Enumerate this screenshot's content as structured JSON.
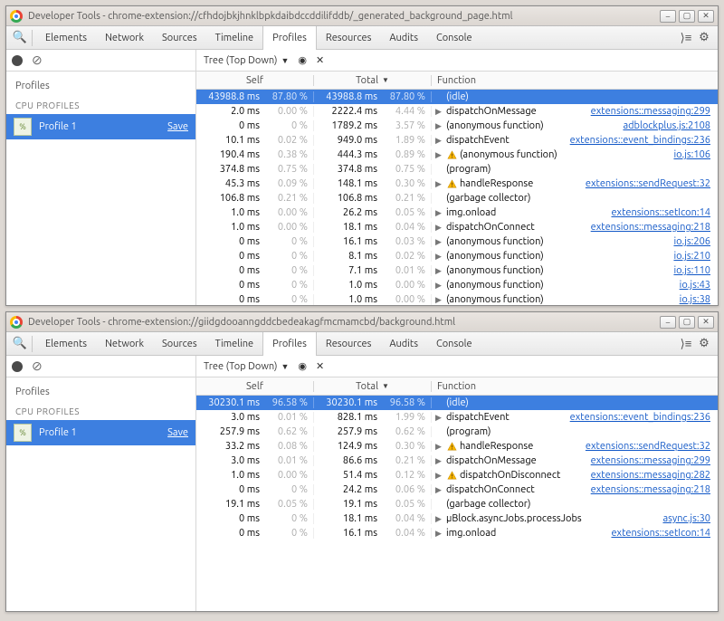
{
  "tabs": [
    "Elements",
    "Network",
    "Sources",
    "Timeline",
    "Profiles",
    "Resources",
    "Audits",
    "Console"
  ],
  "activeTab": "Profiles",
  "sidebar": {
    "profiles_label": "Profiles",
    "cpu_label": "CPU PROFILES",
    "profile": {
      "name": "Profile 1",
      "save": "Save"
    }
  },
  "tree": {
    "mode": "Tree (Top Down)",
    "col_self": "Self",
    "col_total": "Total",
    "col_fn": "Function"
  },
  "windows": [
    {
      "title": "Developer Tools - chrome-extension://cfhdojbkjhnklbpkdaibdccddilifddb/_generated_background_page.html",
      "rows": [
        {
          "sel": true,
          "s": "43988.8 ms",
          "sp": "87.80 %",
          "t": "43988.8 ms",
          "tp": "87.80 %",
          "fn": "(idle)"
        },
        {
          "s": "2.0 ms",
          "sp": "0.00 %",
          "t": "2222.4 ms",
          "tp": "4.44 %",
          "tri": true,
          "fn": "dispatchOnMessage",
          "link": "extensions::messaging:299"
        },
        {
          "s": "0 ms",
          "sp": "0 %",
          "t": "1789.2 ms",
          "tp": "3.57 %",
          "tri": true,
          "fn": "(anonymous function)",
          "link": "adblockplus.js:2108"
        },
        {
          "s": "10.1 ms",
          "sp": "0.02 %",
          "t": "949.0 ms",
          "tp": "1.89 %",
          "tri": true,
          "fn": "dispatchEvent",
          "link": "extensions::event_bindings:236"
        },
        {
          "s": "190.4 ms",
          "sp": "0.38 %",
          "t": "444.3 ms",
          "tp": "0.89 %",
          "tri": true,
          "warn": true,
          "fn": "(anonymous function)",
          "link": "io.js:106"
        },
        {
          "s": "374.8 ms",
          "sp": "0.75 %",
          "t": "374.8 ms",
          "tp": "0.75 %",
          "fn": "(program)"
        },
        {
          "s": "45.3 ms",
          "sp": "0.09 %",
          "t": "148.1 ms",
          "tp": "0.30 %",
          "tri": true,
          "warn": true,
          "fn": "handleResponse",
          "link": "extensions::sendRequest:32"
        },
        {
          "s": "106.8 ms",
          "sp": "0.21 %",
          "t": "106.8 ms",
          "tp": "0.21 %",
          "fn": "(garbage collector)"
        },
        {
          "s": "1.0 ms",
          "sp": "0.00 %",
          "t": "26.2 ms",
          "tp": "0.05 %",
          "tri": true,
          "fn": "img.onload",
          "link": "extensions::setIcon:14"
        },
        {
          "s": "1.0 ms",
          "sp": "0.00 %",
          "t": "18.1 ms",
          "tp": "0.04 %",
          "tri": true,
          "fn": "dispatchOnConnect",
          "link": "extensions::messaging:218"
        },
        {
          "s": "0 ms",
          "sp": "0 %",
          "t": "16.1 ms",
          "tp": "0.03 %",
          "tri": true,
          "fn": "(anonymous function)",
          "link": "io.js:206"
        },
        {
          "s": "0 ms",
          "sp": "0 %",
          "t": "8.1 ms",
          "tp": "0.02 %",
          "tri": true,
          "fn": "(anonymous function)",
          "link": "io.js:210"
        },
        {
          "s": "0 ms",
          "sp": "0 %",
          "t": "7.1 ms",
          "tp": "0.01 %",
          "tri": true,
          "fn": "(anonymous function)",
          "link": "io.js:110"
        },
        {
          "s": "0 ms",
          "sp": "0 %",
          "t": "1.0 ms",
          "tp": "0.00 %",
          "tri": true,
          "fn": "(anonymous function)",
          "link": "io.js:43"
        },
        {
          "s": "0 ms",
          "sp": "0 %",
          "t": "1.0 ms",
          "tp": "0.00 %",
          "tri": true,
          "fn": "(anonymous function)",
          "link": "io.js:38"
        }
      ]
    },
    {
      "title": "Developer Tools - chrome-extension://giidgdooanngddcbedeakagfmcmamcbd/background.html",
      "rows": [
        {
          "sel": true,
          "s": "30230.1 ms",
          "sp": "96.58 %",
          "t": "30230.1 ms",
          "tp": "96.58 %",
          "fn": "(idle)"
        },
        {
          "s": "3.0 ms",
          "sp": "0.01 %",
          "t": "828.1 ms",
          "tp": "1.99 %",
          "tri": true,
          "fn": "dispatchEvent",
          "link": "extensions::event_bindings:236"
        },
        {
          "s": "257.9 ms",
          "sp": "0.62 %",
          "t": "257.9 ms",
          "tp": "0.62 %",
          "fn": "(program)"
        },
        {
          "s": "33.2 ms",
          "sp": "0.08 %",
          "t": "124.9 ms",
          "tp": "0.30 %",
          "tri": true,
          "warn": true,
          "fn": "handleResponse",
          "link": "extensions::sendRequest:32"
        },
        {
          "s": "3.0 ms",
          "sp": "0.01 %",
          "t": "86.6 ms",
          "tp": "0.21 %",
          "tri": true,
          "fn": "dispatchOnMessage",
          "link": "extensions::messaging:299"
        },
        {
          "s": "1.0 ms",
          "sp": "0.00 %",
          "t": "51.4 ms",
          "tp": "0.12 %",
          "tri": true,
          "warn": true,
          "fn": "dispatchOnDisconnect",
          "link": "extensions::messaging:282"
        },
        {
          "s": "0 ms",
          "sp": "0 %",
          "t": "24.2 ms",
          "tp": "0.06 %",
          "tri": true,
          "fn": "dispatchOnConnect",
          "link": "extensions::messaging:218"
        },
        {
          "s": "19.1 ms",
          "sp": "0.05 %",
          "t": "19.1 ms",
          "tp": "0.05 %",
          "fn": "(garbage collector)"
        },
        {
          "s": "0 ms",
          "sp": "0 %",
          "t": "18.1 ms",
          "tp": "0.04 %",
          "tri": true,
          "fn": "µBlock.asyncJobs.processJobs",
          "link": "async.js:30"
        },
        {
          "s": "0 ms",
          "sp": "0 %",
          "t": "16.1 ms",
          "tp": "0.04 %",
          "tri": true,
          "fn": "img.onload",
          "link": "extensions::setIcon:14"
        }
      ]
    }
  ]
}
